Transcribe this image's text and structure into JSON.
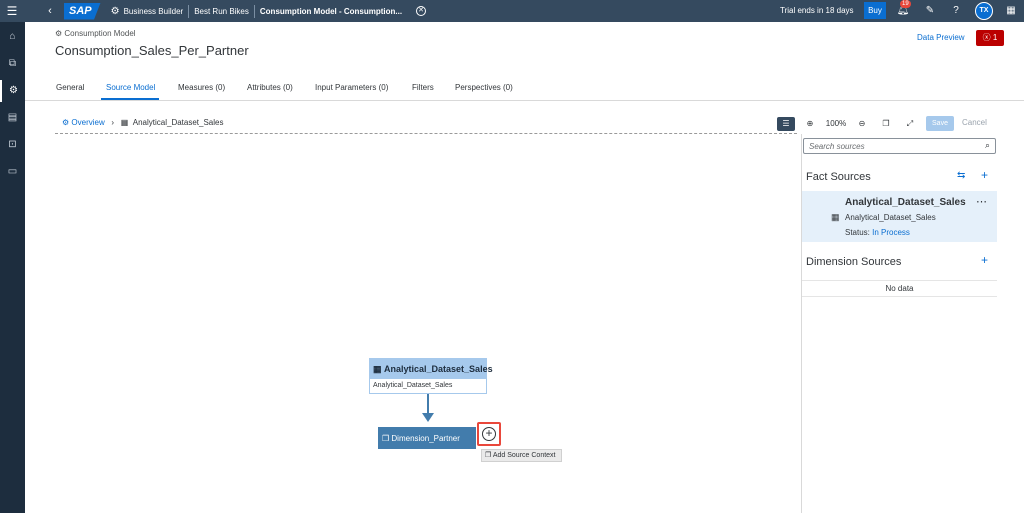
{
  "shell": {
    "menu_icon": "hamburger-icon",
    "back_icon": "chevron-left-icon",
    "logo": "SAP",
    "app_name": "Business Builder",
    "space_name": "Best Run Bikes",
    "object_title": "Consumption Model - Consumption...",
    "trial_text": "Trial ends in 18 days",
    "buy_label": "Buy",
    "notification_count": "19",
    "avatar_initials": "TX"
  },
  "sidenav": {
    "items": [
      "home-icon",
      "data-builder-icon",
      "business-builder-icon",
      "data-integration-icon",
      "security-icon",
      "system-monitor-icon"
    ]
  },
  "header": {
    "object_type": "Consumption Model",
    "title": "Consumption_Sales_Per_Partner",
    "data_preview_label": "Data Preview",
    "error_count": "1"
  },
  "tabs": [
    {
      "label": "General"
    },
    {
      "label": "Source Model"
    },
    {
      "label": "Measures (0)"
    },
    {
      "label": "Attributes (0)"
    },
    {
      "label": "Input Parameters (0)"
    },
    {
      "label": "Filters"
    },
    {
      "label": "Perspectives (0)"
    }
  ],
  "active_tab": "Source Model",
  "toolbar": {
    "breadcrumb_overview": "Overview",
    "breadcrumb_current": "Analytical_Dataset_Sales",
    "zoom_level": "100%",
    "save_label": "Save",
    "cancel_label": "Cancel"
  },
  "panel": {
    "search_placeholder": "Search sources",
    "fact_sources_title": "Fact Sources",
    "fact_item": {
      "name": "Analytical_Dataset_Sales",
      "technical_name": "Analytical_Dataset_Sales",
      "status_label": "Status:",
      "status_value": "In Process"
    },
    "dimension_sources_title": "Dimension Sources",
    "no_data_text": "No data"
  },
  "canvas": {
    "fact_node_title": "Analytical_Dataset_Sales",
    "fact_node_subtitle": "Analytical_Dataset_Sales",
    "dimension_node_title": "Dimension_Partner",
    "add_tooltip": "Add Source Context"
  },
  "colors": {
    "shell": "#354a5f",
    "sidenav": "#1d2d3e",
    "accent": "#0a6ed1",
    "error": "#bb0000",
    "dimension_node": "#427cac",
    "fact_node_header": "#a6c9ec",
    "highlight": "#e9473b"
  }
}
